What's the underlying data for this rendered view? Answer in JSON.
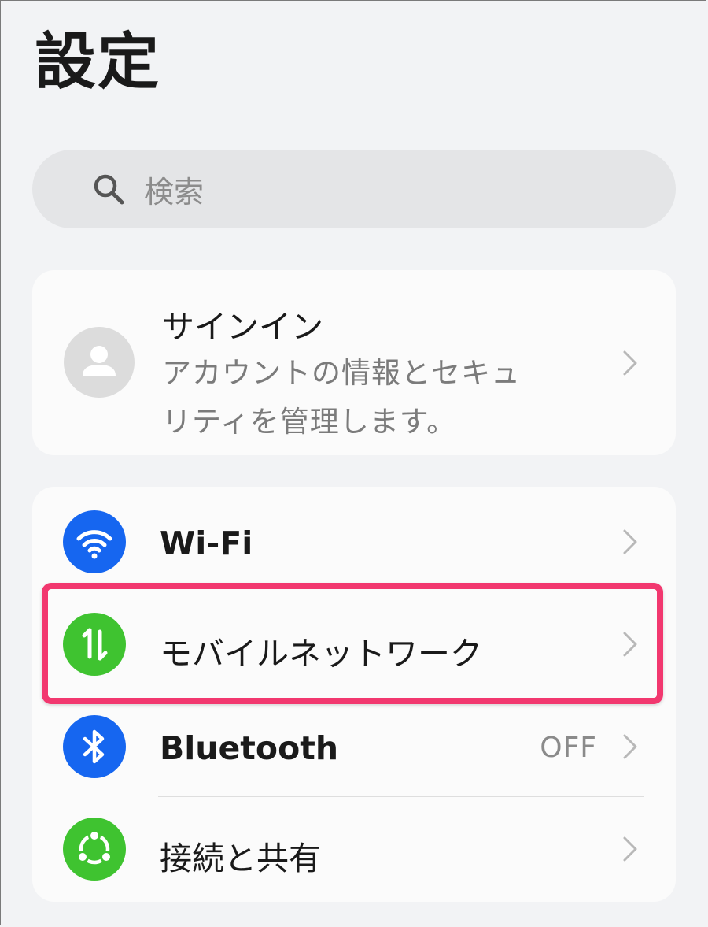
{
  "header": {
    "title": "設定"
  },
  "search": {
    "placeholder": "検索"
  },
  "account": {
    "title": "サインイン",
    "description": "アカウントの情報とセキュリティを管理します。"
  },
  "settings": {
    "items": [
      {
        "label": "Wi-Fi",
        "icon": "wifi-icon",
        "color": "#1666f0",
        "value": ""
      },
      {
        "label": "モバイルネットワーク",
        "icon": "mobile-data-icon",
        "color": "#3fc330",
        "value": ""
      },
      {
        "label": "Bluetooth",
        "icon": "bluetooth-icon",
        "color": "#1666f0",
        "value": "OFF"
      },
      {
        "label": "接続と共有",
        "icon": "share-icon",
        "color": "#3fc330",
        "value": ""
      }
    ]
  },
  "colors": {
    "highlight": "#f2386f",
    "background": "#f2f3f5",
    "card": "#fbfbfb"
  }
}
